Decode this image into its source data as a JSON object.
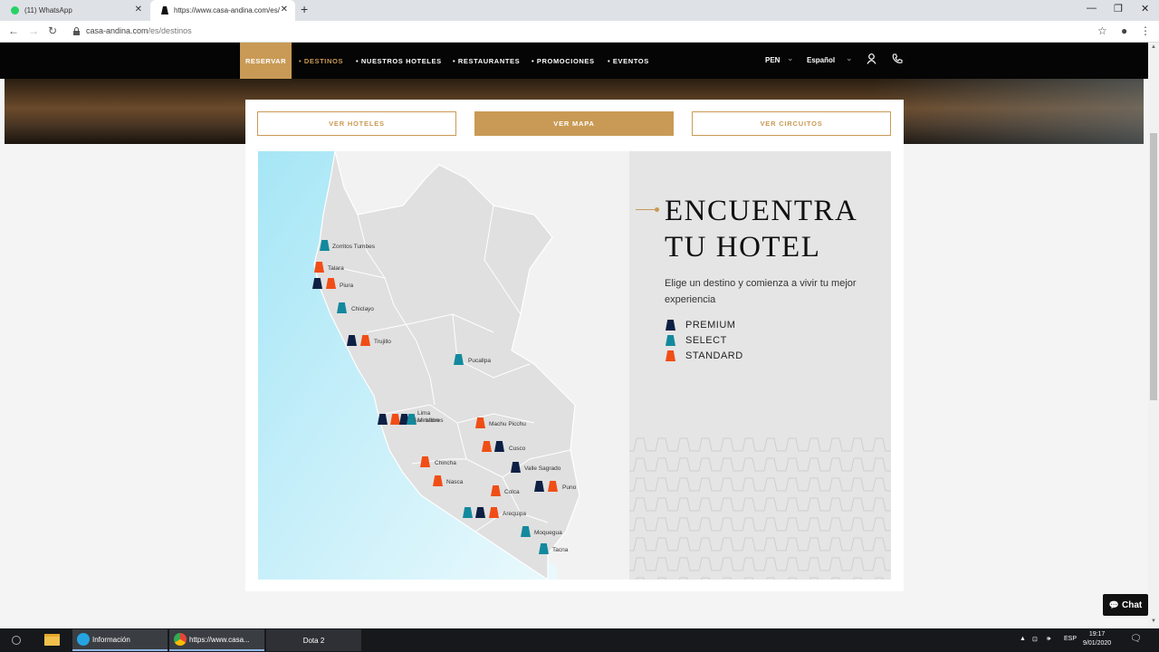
{
  "browser": {
    "tabs": [
      {
        "title": "(11) WhatsApp",
        "icon": "whatsapp-icon"
      },
      {
        "title": "https://www.casa-andina.com/es/",
        "icon": "casa-andina-icon"
      }
    ],
    "url_host": "casa-andina.com",
    "url_path": "/es/destinos"
  },
  "sitenav": {
    "reservar": "RESERVAR",
    "links": [
      "• DESTINOS",
      "• NUESTROS HOTELES",
      "• RESTAURANTES",
      "• PROMOCIONES",
      "• EVENTOS"
    ],
    "currency": "PEN",
    "language": "Español"
  },
  "buttons": {
    "ver_hoteles": "VER HOTELES",
    "ver_mapa": "VER MAPA",
    "ver_circuitos": "VER CIRCUITOS"
  },
  "info": {
    "headline_1": "ENCUENTRA",
    "headline_2": "TU HOTEL",
    "subtitle": "Elige un destino y comienza a vivir tu mejor experiencia",
    "legend": [
      {
        "label": "PREMIUM",
        "color": "#0e1f44"
      },
      {
        "label": "SELECT",
        "color": "#13899d"
      },
      {
        "label": "STANDARD",
        "color": "#f04e16"
      }
    ]
  },
  "cities": {
    "zorritos": "Zorritos Tumbes",
    "talara": "Talara",
    "piura": "Piura",
    "chiclayo": "Chiclayo",
    "trujillo": "Trujillo",
    "pucallpa": "Pucallpa",
    "lima": "Lima",
    "miraflores": "Miraflores",
    "san_isidro": "San Isidro",
    "machu_picchu": "Machu Picchu",
    "cusco": "Cusco",
    "valle_sagrado": "Valle Sagrado",
    "chincha": "Chincha",
    "nasca": "Nasca",
    "colca": "Colca",
    "puno": "Puno",
    "arequipa": "Arequipa",
    "moquegua": "Moquegua",
    "tacna": "Tacna"
  },
  "chat_label": "Chat",
  "taskbar": {
    "items": [
      "Información",
      "https://www.casa...",
      "Dota 2"
    ],
    "lang": "ESP",
    "time": "19:17",
    "date": "9/01/2020"
  },
  "colors": {
    "accent": "#c99a55",
    "premium": "#0e1f44",
    "select": "#13899d",
    "standard": "#f04e16"
  }
}
